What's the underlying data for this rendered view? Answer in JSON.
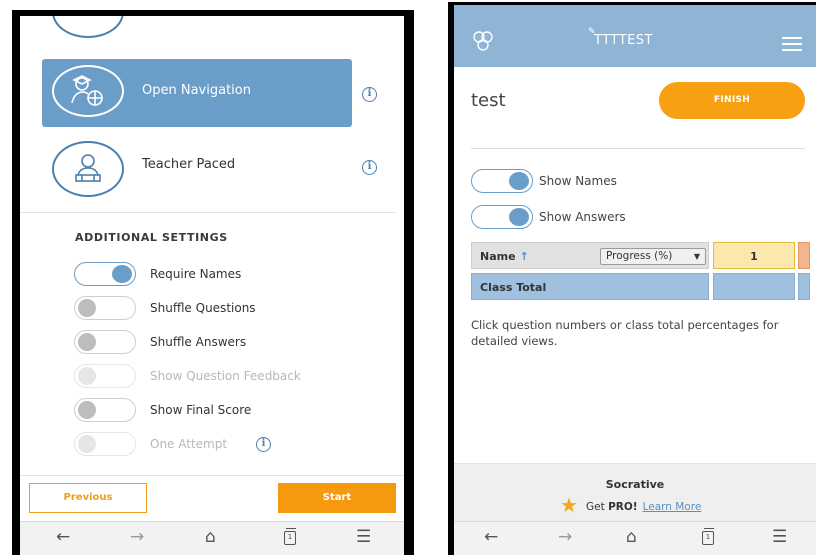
{
  "left_screen": {
    "modes": [
      {
        "label": "Open Navigation"
      },
      {
        "label": "Teacher Paced"
      }
    ],
    "additional_settings_title": "ADDITIONAL SETTINGS",
    "settings": [
      {
        "label": "Require Names",
        "state": "on"
      },
      {
        "label": "Shuffle Questions",
        "state": "off"
      },
      {
        "label": "Shuffle Answers",
        "state": "off"
      },
      {
        "label": "Show Question Feedback",
        "state": "disabled"
      },
      {
        "label": "Show Final Score",
        "state": "off"
      },
      {
        "label": "One Attempt",
        "state": "disabled"
      }
    ],
    "previous_label": "Previous",
    "start_label": "Start",
    "info_glyph": "i"
  },
  "right_screen": {
    "room_name": "TTTTEST",
    "quiz_name": "test",
    "finish_label": "FINISH",
    "show_names_label": "Show Names",
    "show_answers_label": "Show Answers",
    "table": {
      "name_header": "Name",
      "sort_arrow": "↑",
      "progress_select": "Progress (%)",
      "question_number": "1",
      "class_total_label": "Class Total"
    },
    "hint_text": "Click question numbers or class total percentages for detailed views.",
    "footer": {
      "brand": "Socrative",
      "get_label": "Get ",
      "pro_label": "PRO!",
      "learn_more": "Learn More"
    }
  },
  "browser_nav": {
    "back": "←",
    "forward": "→",
    "home": "⌂",
    "tabs_count": "1",
    "menu": "☰"
  },
  "colors": {
    "accent_blue": "#6a9ec8",
    "header_blue": "#8fb5d6",
    "orange": "#f7990f"
  }
}
